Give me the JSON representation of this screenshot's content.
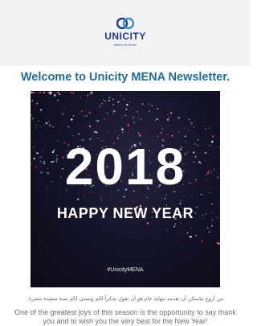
{
  "header": {
    "logo_wordmark": "UNICITY",
    "logo_tagline": "Make Life Better",
    "brand_color": "#1f3a8a"
  },
  "newsletter": {
    "headline": "Welcome to Unicity MENA Newsletter.",
    "headline_color": "#1f6e9a"
  },
  "hero": {
    "year": "2018",
    "greeting": "HAPPY NEW YEAR",
    "hashtag": "#UnicityMENA"
  },
  "body": {
    "arabic_text": "من أروع مايمكن أن نقدمه بنهاية عام هو أن نقول شكراً لكم ونتمنى لكم سنة سعيدة مثمرة.",
    "english_text": "One of the greatest joys of this season is the opportunity to say thank you and to wish you the very best for the New Year!"
  }
}
